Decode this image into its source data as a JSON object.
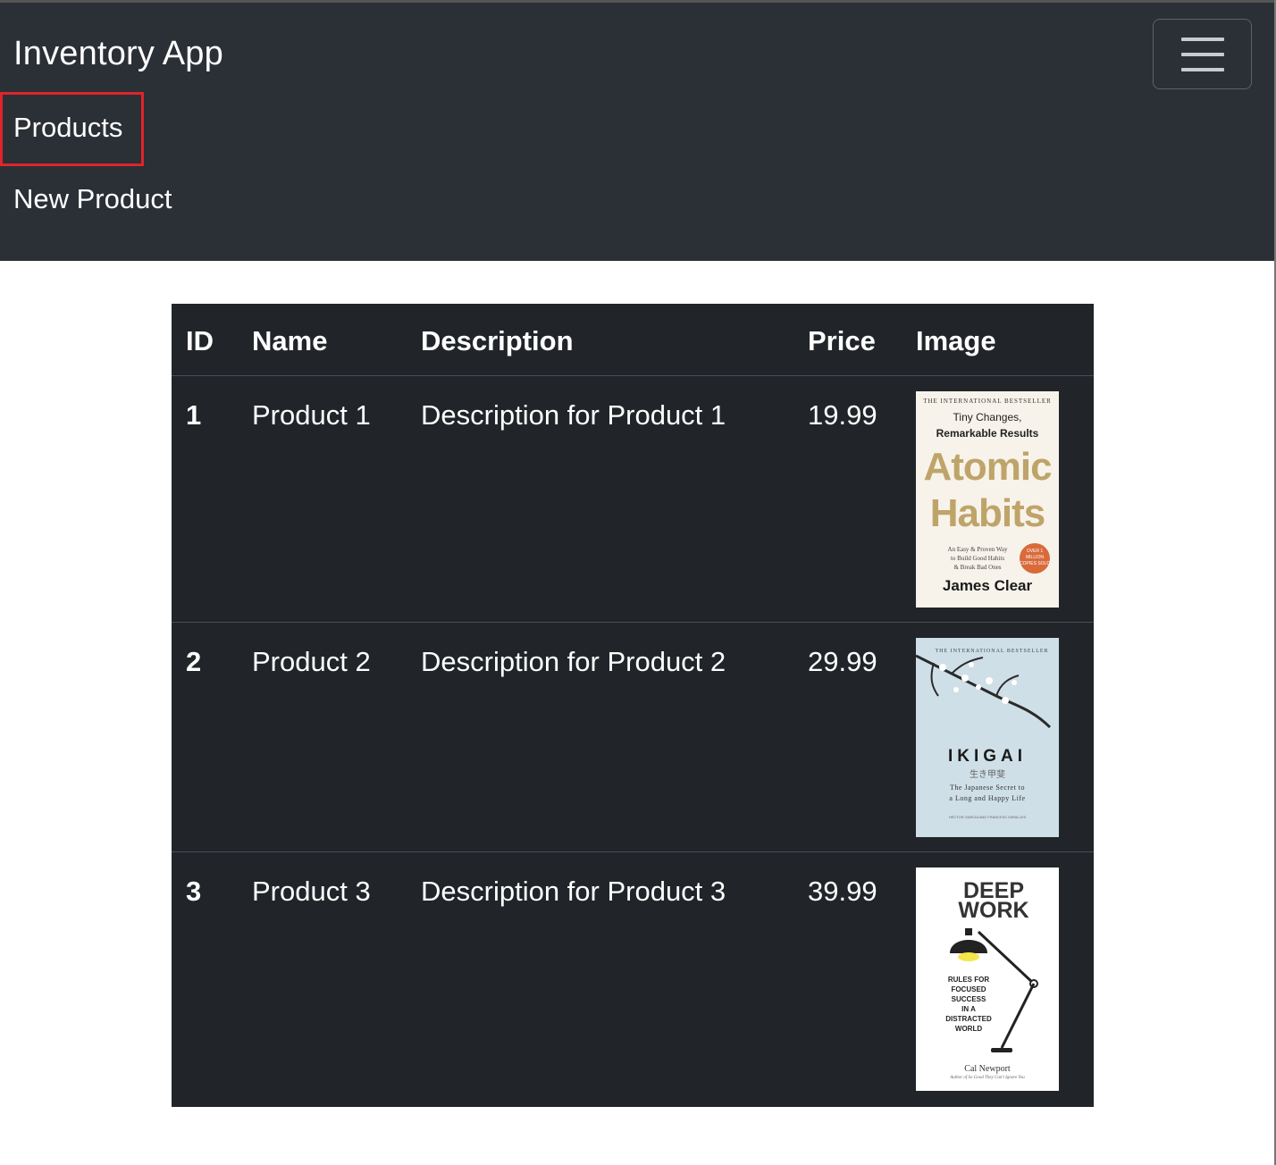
{
  "navbar": {
    "brand": "Inventory App",
    "links": [
      {
        "label": "Products",
        "highlighted": true
      },
      {
        "label": "New Product"
      }
    ],
    "toggler_icon": "hamburger-icon"
  },
  "table": {
    "headers": [
      "ID",
      "Name",
      "Description",
      "Price",
      "Image"
    ],
    "rows": [
      {
        "id": "1",
        "name": "Product 1",
        "description": "Description for Product 1",
        "price": "19.99",
        "cover": {
          "top": "THE INTERNATIONAL BESTSELLER",
          "sub1": "Tiny Changes,",
          "sub2": "Remarkable Results",
          "title1": "Atomic",
          "title2": "Habits",
          "tag1": "An Easy & Proven Way",
          "tag2": "to Build Good Habits",
          "tag3": "& Break Bad Ones",
          "badge": "OVER 1 MILLION COPIES SOLD",
          "author": "James Clear"
        }
      },
      {
        "id": "2",
        "name": "Product 2",
        "description": "Description for Product 2",
        "price": "29.99",
        "cover": {
          "top": "THE INTERNATIONAL BESTSELLER",
          "title": "IKIGAI",
          "kanji": "生き甲斐",
          "sub1": "The Japanese Secret to",
          "sub2": "a Long and Happy Life",
          "authors": "HÉCTOR GARCÍA AND FRANCESC MIRALLES"
        }
      },
      {
        "id": "3",
        "name": "Product 3",
        "description": "Description for Product 3",
        "price": "39.99",
        "cover": {
          "title1": "DEEP",
          "title2": "WORK",
          "l1": "RULES FOR",
          "l2": "FOCUSED",
          "l3": "SUCCESS",
          "l4": "IN A",
          "l5": "DISTRACTED",
          "l6": "WORLD",
          "author": "Cal Newport",
          "byline": "Author of So Good They Can't Ignore You"
        }
      }
    ]
  },
  "colors": {
    "navbar_bg": "#2b2f36",
    "table_bg": "#212529",
    "highlight": "#e0242b"
  }
}
